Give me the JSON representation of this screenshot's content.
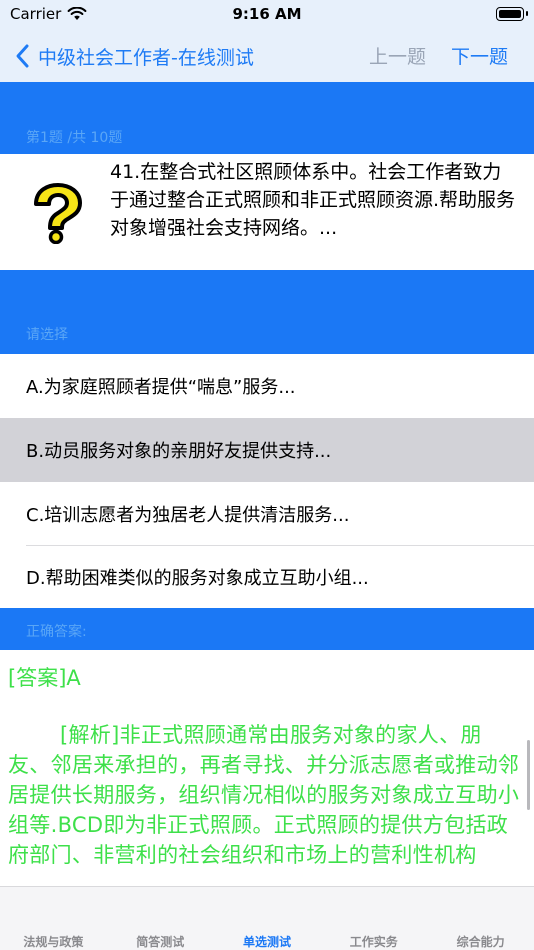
{
  "status": {
    "carrier": "Carrier",
    "time": "9:16 AM"
  },
  "nav": {
    "title": "中级社会工作者-在线测试",
    "prev": "上一题",
    "next": "下一题"
  },
  "question_header": "第1题 /共 10题",
  "question_text": "41.在整合式社区照顾体系中。社会工作者致力于通过整合正式照顾和非正式照顾资源.帮助服务对象增强社会支持网络。...",
  "choose_header": "请选择",
  "options": [
    "A.为家庭照顾者提供“喘息”服务...",
    "B.动员服务对象的亲朋好友提供支持...",
    "C.培训志愿者为独居老人提供清洁服务...",
    "D.帮助困难类似的服务对象成立互助小组..."
  ],
  "answer_header": "正确答案:",
  "answer_label": "[答案]A",
  "analysis": "[解析]非正式照顾通常由服务对象的家人、朋友、邻居来承担的，再者寻找、并分派志愿者或推动邻居提供长期服务，组织情况相似的服务对象成立互助小组等.BCD即为非正式照顾。正式照顾的提供方包括政府部门、非营利的社会组织和市场上的营利性机构",
  "tabs": [
    "法规与政策",
    "简答测试",
    "单选测试",
    "工作实务",
    "综合能力"
  ],
  "colors": {
    "accent": "#1b78f5",
    "answer_green": "#3ee04a",
    "selected_option": "#d2d2d7"
  }
}
